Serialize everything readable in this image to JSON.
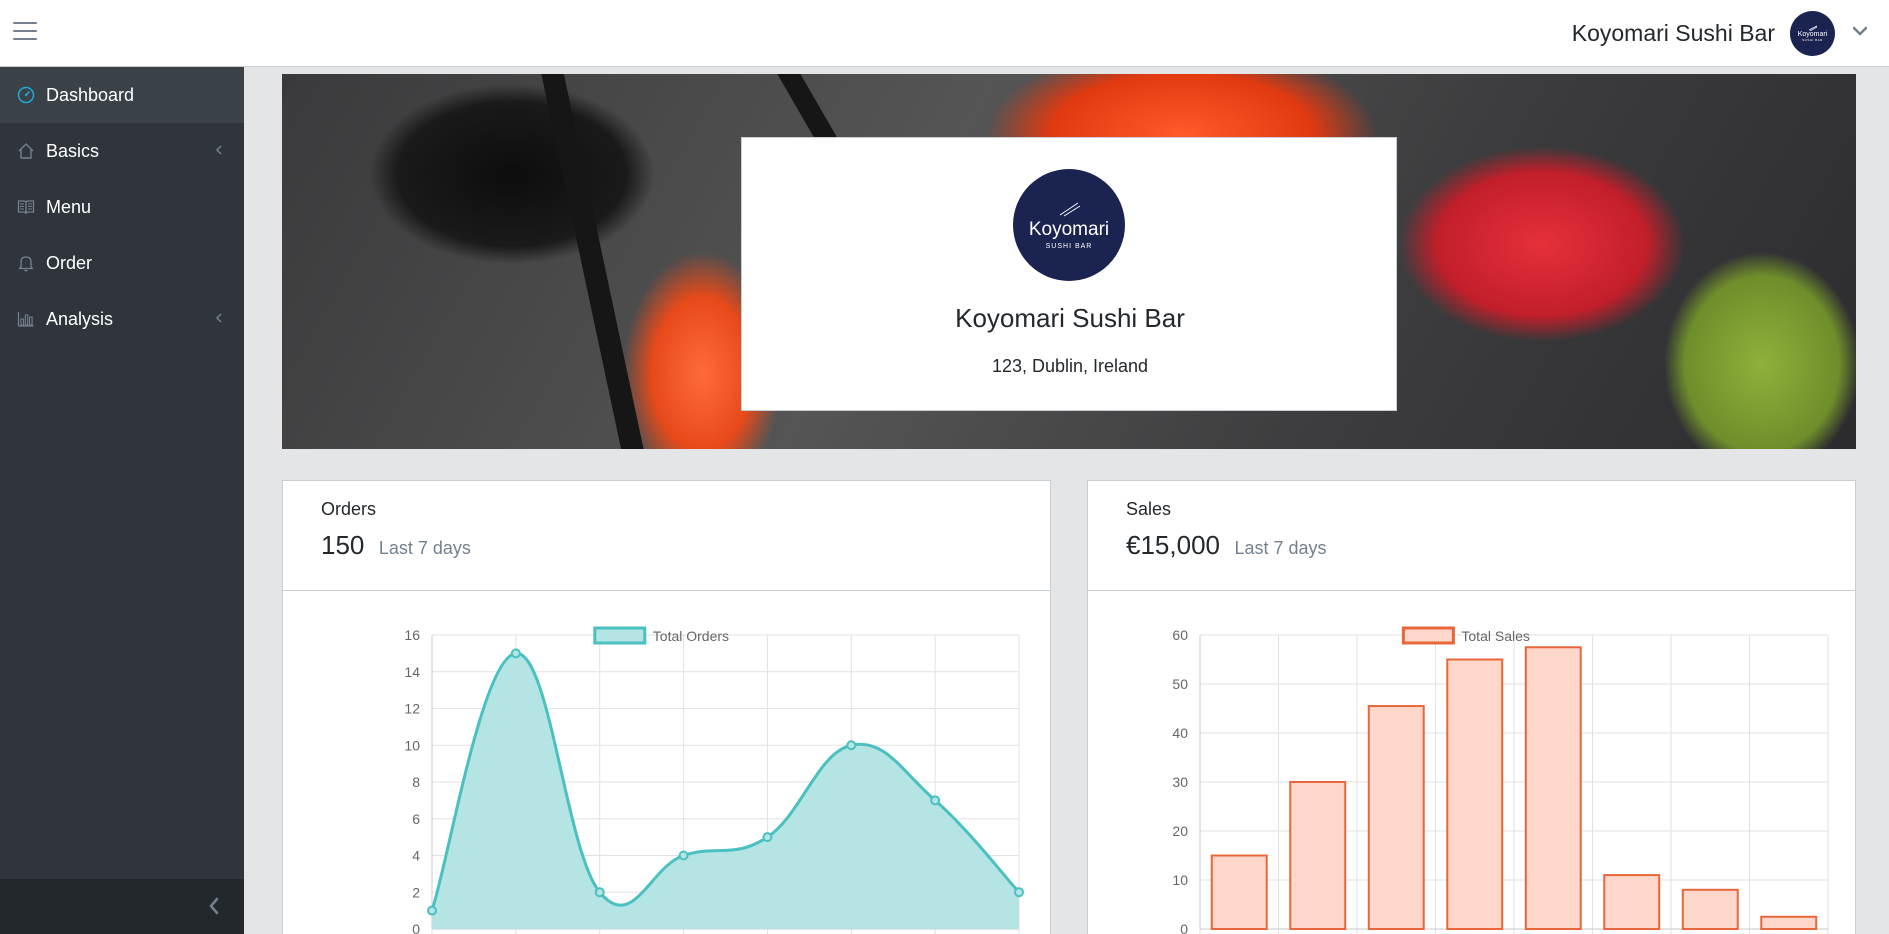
{
  "header": {
    "brand_name": "Koyomari Sushi Bar",
    "avatar": {
      "main": "Koyomari",
      "sub": "SUSHI BAR"
    }
  },
  "sidebar": {
    "items": [
      {
        "label": "Dashboard",
        "icon": "speedometer-icon",
        "active": true,
        "has_submenu": false
      },
      {
        "label": "Basics",
        "icon": "home-icon",
        "active": false,
        "has_submenu": true
      },
      {
        "label": "Menu",
        "icon": "book-icon",
        "active": false,
        "has_submenu": false
      },
      {
        "label": "Order",
        "icon": "bell-icon",
        "active": false,
        "has_submenu": false
      },
      {
        "label": "Analysis",
        "icon": "bar-chart-icon",
        "active": false,
        "has_submenu": true
      }
    ]
  },
  "restaurant": {
    "logo_main": "Koyomari",
    "logo_sub": "SUSHI BAR",
    "name": "Koyomari Sushi Bar",
    "address": "123, Dublin, Ireland"
  },
  "orders_card": {
    "title": "Orders",
    "value": "150",
    "period": "Last 7 days"
  },
  "sales_card": {
    "title": "Sales",
    "value": "€15,000",
    "period": "Last 7 days"
  },
  "colors": {
    "teal": "#4bc0c0",
    "teal_fill": "#b5e4e4",
    "orange": "#e8673a",
    "orange_fill": "#fdd7c9",
    "navy": "#1b2350",
    "sidebar": "#2f353a"
  },
  "chart_data": [
    {
      "type": "area",
      "legend": [
        "Total Orders"
      ],
      "x": [
        0,
        1,
        2,
        3,
        4,
        5,
        6,
        7
      ],
      "series": [
        {
          "name": "Total Orders",
          "values": [
            1,
            15,
            2,
            4,
            5,
            10,
            7,
            2
          ]
        }
      ],
      "ylim": [
        0,
        16
      ],
      "yticks": [
        0,
        2,
        4,
        6,
        8,
        10,
        12,
        14,
        16
      ],
      "grid": true,
      "legend_position": "top"
    },
    {
      "type": "bar",
      "legend": [
        "Total Sales"
      ],
      "categories": [
        "",
        "",
        "",
        "",
        "",
        "",
        "",
        ""
      ],
      "series": [
        {
          "name": "Total Sales",
          "values": [
            15,
            30,
            45.5,
            55,
            57.5,
            11,
            8,
            2.5
          ]
        }
      ],
      "ylim": [
        0,
        60
      ],
      "yticks": [
        0,
        10,
        20,
        30,
        40,
        50,
        60
      ],
      "grid": true,
      "legend_position": "top"
    }
  ]
}
